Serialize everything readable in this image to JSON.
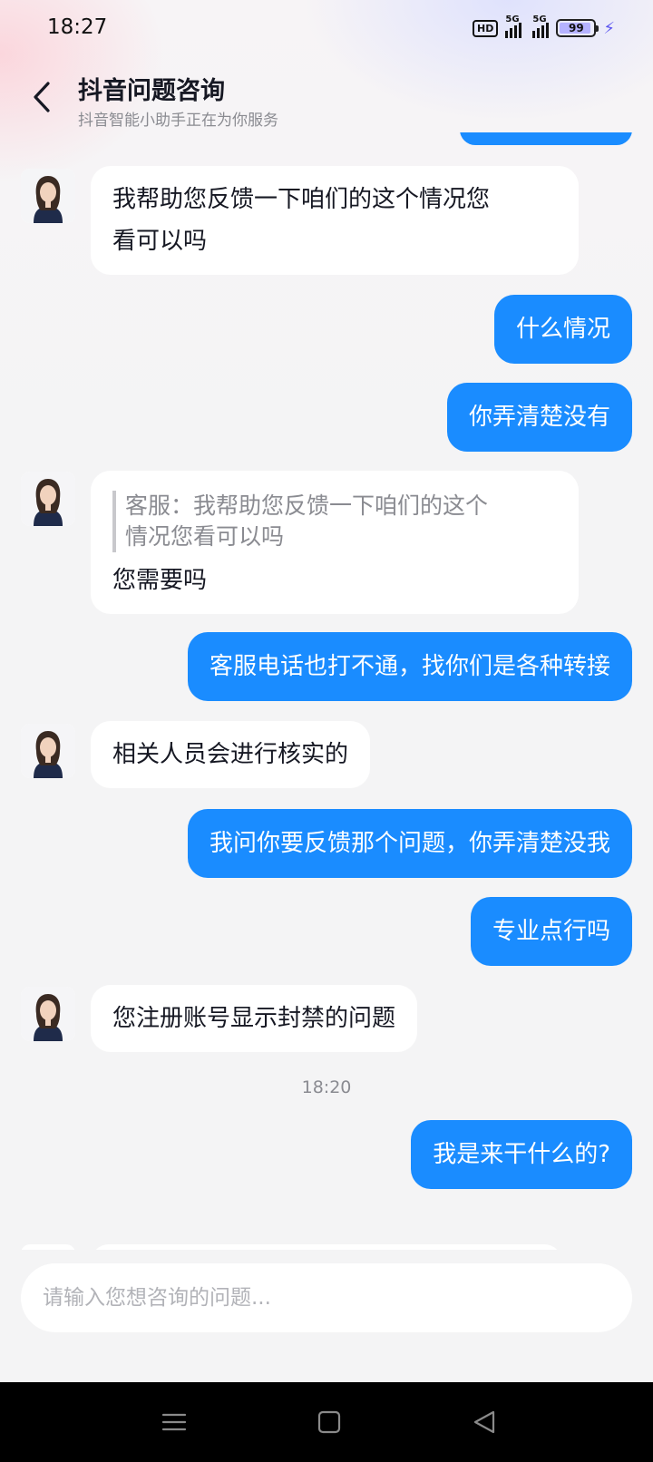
{
  "status_bar": {
    "time": "18:27",
    "hd_badge": "HD",
    "signal1_label": "5G",
    "signal2_label": "5G",
    "battery_level": "99"
  },
  "header": {
    "title": "抖音问题咨询",
    "subtitle": "抖音智能小助手正在为你服务"
  },
  "messages": [
    {
      "from": "bot",
      "text_line1": "我帮助您反馈一下咱们的这个情况您",
      "text_line2": "看可以吗"
    },
    {
      "from": "user",
      "text": "什么情况"
    },
    {
      "from": "user",
      "text": "你弄清楚没有"
    },
    {
      "from": "bot",
      "quote_line1": "客服：我帮助您反馈一下咱们的这个",
      "quote_line2": "情况您看可以吗",
      "text": "您需要吗"
    },
    {
      "from": "user",
      "text": "客服电话也打不通，找你们是各种转接"
    },
    {
      "from": "bot",
      "text": "相关人员会进行核实的"
    },
    {
      "from": "user",
      "text": "我问你要反馈那个问题，你弄清楚没我"
    },
    {
      "from": "user",
      "text": "专业点行吗"
    },
    {
      "from": "bot",
      "text": "您注册账号显示封禁的问题"
    },
    {
      "from": "user",
      "text": "我是来干什么的?"
    }
  ],
  "timestamp": "18:20",
  "input": {
    "placeholder": "请输入您想咨询的问题..."
  },
  "colors": {
    "user_bubble": "#1a8cff",
    "bot_bubble": "#ffffff",
    "background": "#f4f4f5"
  },
  "icons": {
    "back": "chevron-left-icon",
    "menu": "menu-icon",
    "home": "home-icon",
    "nav_back": "triangle-back-icon"
  }
}
